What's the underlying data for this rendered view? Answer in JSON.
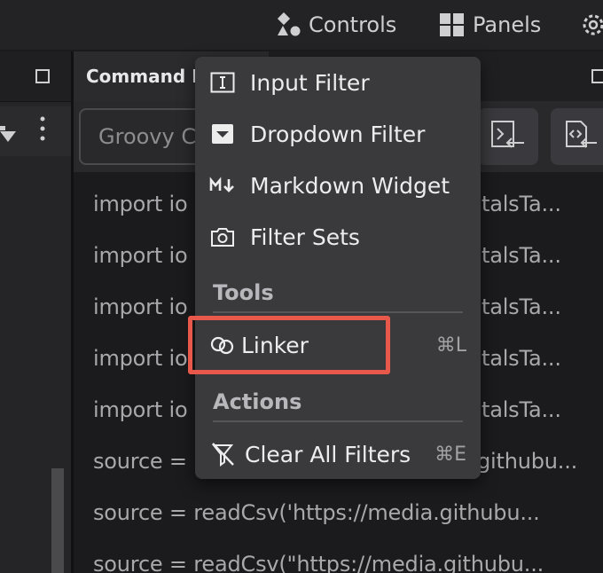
{
  "topbar": {
    "controls_label": "Controls",
    "panels_label": "Panels"
  },
  "main": {
    "tab_title": "Command H",
    "select_placeholder": "Groovy C",
    "code_lines": [
      "import io",
      "import io",
      "import io",
      "import io",
      "import io",
      "source = ",
      "source = readCsv('https://media.githubu...",
      "source = readCsv(\"https://media.githubu..."
    ],
    "code_right": [
      "talsTa...",
      "talsTa...",
      "talsTa...",
      "talsTa...",
      "talsTa...",
      "githubu..."
    ]
  },
  "menu": {
    "items": [
      {
        "label": "Input Filter",
        "icon": "input-filter-icon"
      },
      {
        "label": "Dropdown Filter",
        "icon": "dropdown-filter-icon"
      },
      {
        "label": "Markdown Widget",
        "icon": "markdown-icon"
      },
      {
        "label": "Filter Sets",
        "icon": "camera-icon"
      }
    ],
    "tools_header": "Tools",
    "linker": {
      "label": "Linker",
      "shortcut": "⌘L",
      "icon": "link-icon"
    },
    "actions_header": "Actions",
    "clear": {
      "label": "Clear All Filters",
      "shortcut": "⌘E",
      "icon": "clear-filter-icon"
    }
  },
  "colors": {
    "highlight": "#e8594c",
    "menu_bg": "#3a393c"
  }
}
